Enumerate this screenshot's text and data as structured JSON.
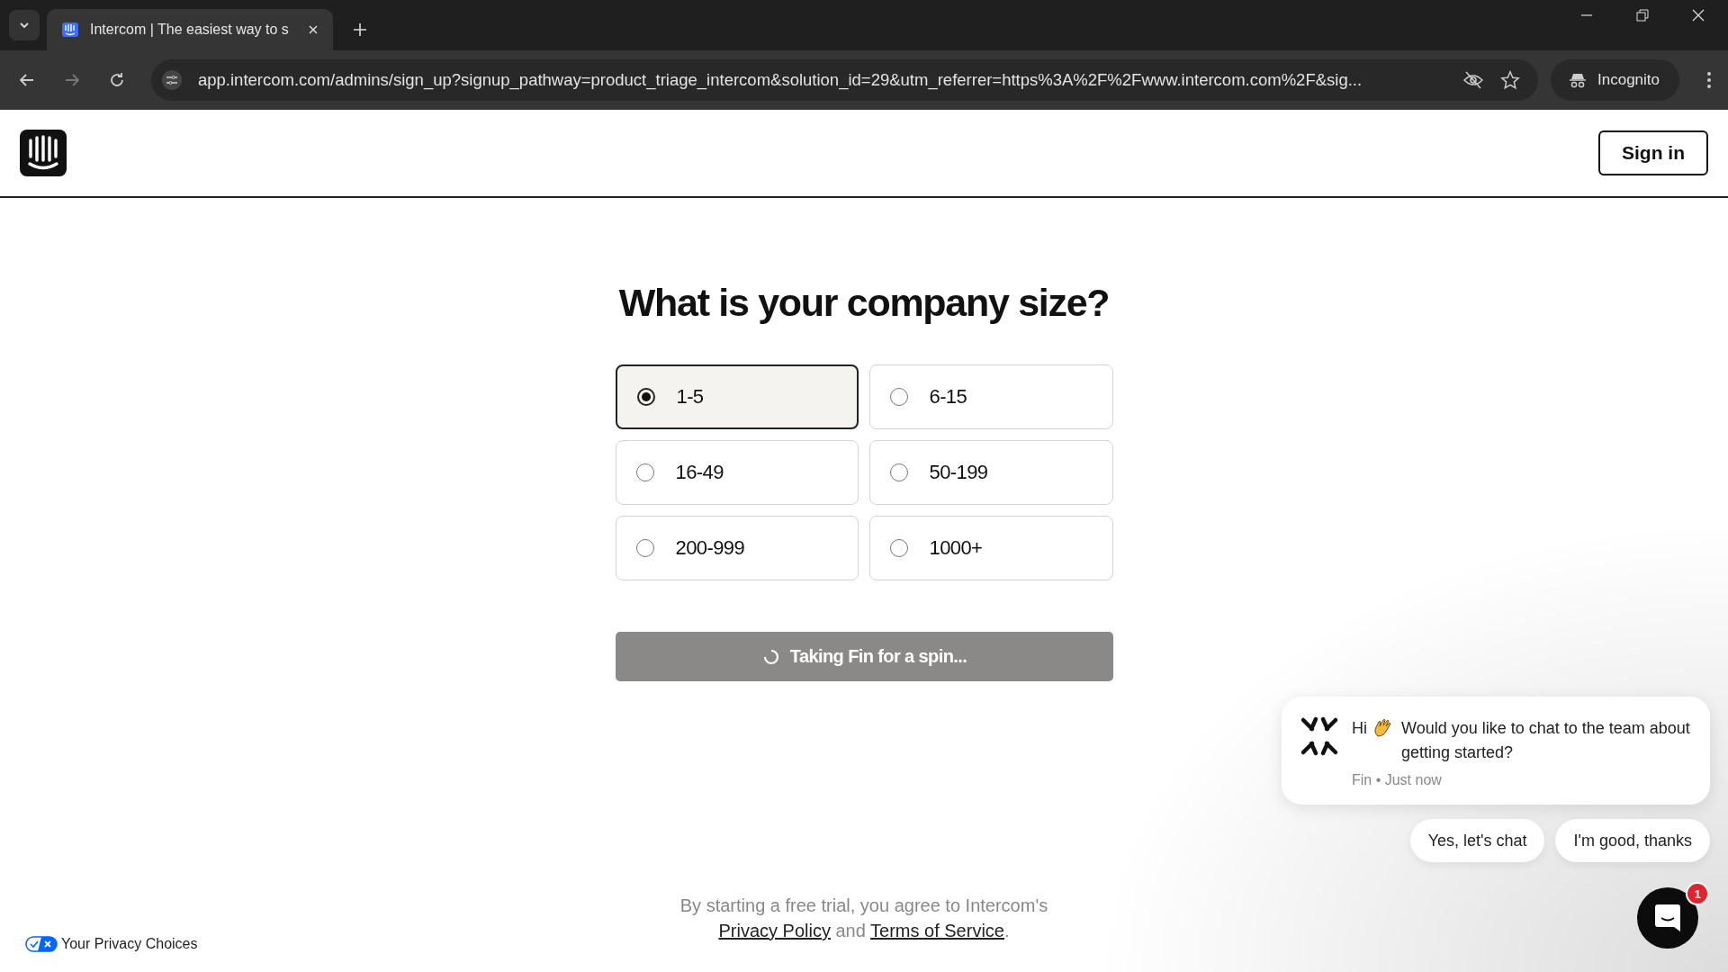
{
  "browser": {
    "tabs": [
      {
        "title": "Intercom | The easiest way to s",
        "selected": true
      }
    ],
    "url": "app.intercom.com/admins/sign_up?signup_pathway=product_triage_intercom&solution_id=29&utm_referrer=https%3A%2F%2Fwww.intercom.com%2F&sig...",
    "profile": "Incognito"
  },
  "header": {
    "sign_in": "Sign in"
  },
  "question": "What is your company size?",
  "options": [
    {
      "label": "1-5",
      "selected": true
    },
    {
      "label": "6-15",
      "selected": false
    },
    {
      "label": "16-49",
      "selected": false
    },
    {
      "label": "50-199",
      "selected": false
    },
    {
      "label": "200-999",
      "selected": false
    },
    {
      "label": "1000+",
      "selected": false
    }
  ],
  "submit": {
    "label": "Taking Fin for a spin...",
    "loading": true
  },
  "footer": {
    "lead": "By starting a free trial, you agree to Intercom's",
    "privacy": "Privacy Policy",
    "and": "and",
    "terms": "Terms of Service",
    "end": "."
  },
  "privacy_choices": "Your Privacy Choices",
  "chat": {
    "greeting": "Hi",
    "message": "Would you like to chat to the team about getting started?",
    "meta": "Fin • Just now",
    "replies": [
      "Yes, let's chat",
      "I'm good, thanks"
    ],
    "badge": "1"
  }
}
